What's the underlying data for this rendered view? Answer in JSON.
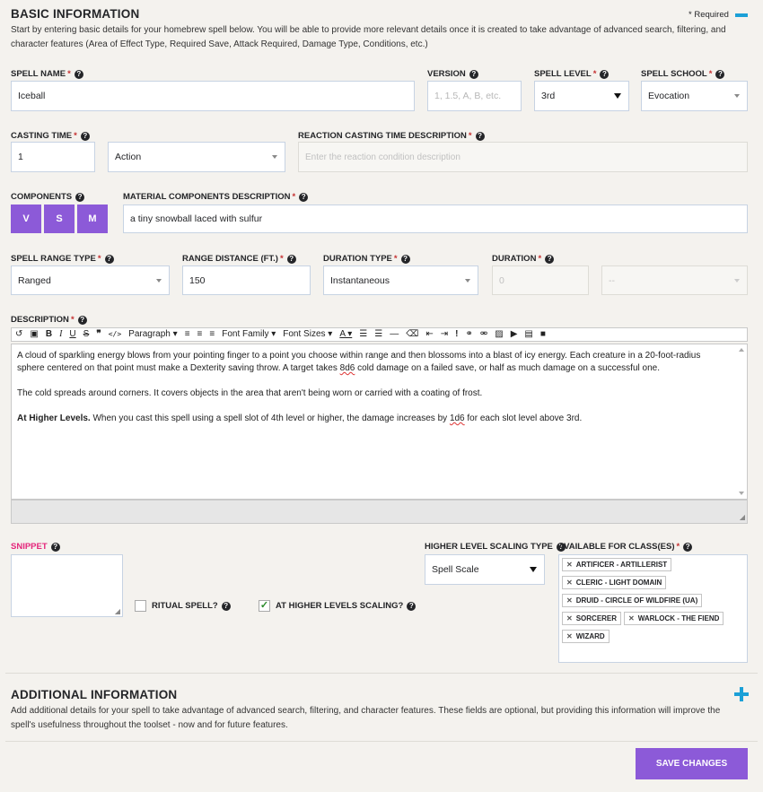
{
  "basic": {
    "title": "BASIC INFORMATION",
    "required_label": "* Required",
    "intro": "Start by entering basic details for your homebrew spell below. You will be able to provide more relevant details once it is created to take advantage of advanced search, filtering, and character features (Area of Effect Type, Required Save, Attack Required, Damage Type, Conditions, etc.)"
  },
  "fields": {
    "spell_name": {
      "label": "SPELL NAME",
      "value": "Iceball"
    },
    "version": {
      "label": "VERSION",
      "placeholder": "1, 1.5, A, B, etc."
    },
    "spell_level": {
      "label": "SPELL LEVEL",
      "value": "3rd"
    },
    "spell_school": {
      "label": "SPELL SCHOOL",
      "value": "Evocation"
    },
    "casting_time": {
      "label": "CASTING TIME",
      "value": "1",
      "unit": "Action"
    },
    "reaction_desc": {
      "label": "REACTION CASTING TIME DESCRIPTION",
      "placeholder": "Enter the reaction condition description"
    },
    "components": {
      "label": "COMPONENTS",
      "v": "V",
      "s": "S",
      "m": "M"
    },
    "material_desc": {
      "label": "MATERIAL COMPONENTS DESCRIPTION",
      "value": "a tiny snowball laced with sulfur"
    },
    "range_type": {
      "label": "SPELL RANGE TYPE",
      "value": "Ranged"
    },
    "range_distance": {
      "label": "RANGE DISTANCE (FT.)",
      "value": "150"
    },
    "duration_type": {
      "label": "DURATION TYPE",
      "value": "Instantaneous"
    },
    "duration": {
      "label": "DURATION",
      "value": "0",
      "unit": "--"
    }
  },
  "description": {
    "label": "DESCRIPTION",
    "toolbar": {
      "paragraph": "Paragraph",
      "font_family": "Font Family",
      "font_sizes": "Font Sizes"
    },
    "p1_a": "A cloud of sparkling energy blows from your pointing finger to a point you choose within range and then blossoms into a blast of icy energy. Each creature in a 20-foot-radius sphere centered on that point must make a Dexterity saving throw. A target takes ",
    "p1_dice": "8d6",
    "p1_b": " cold damage on a failed save, or half as much damage on a successful one.",
    "p2": "The cold spreads around corners. It covers objects in the area that aren't being worn or carried with a coating of frost.",
    "p3_bold": "At Higher Levels.",
    "p3_a": " When you cast this spell using a spell slot of 4th level or higher, the damage increases by ",
    "p3_dice": "1d6",
    "p3_b": " for each slot level above 3rd."
  },
  "snippet": {
    "label": "SNIPPET"
  },
  "ritual": {
    "label": "RITUAL SPELL?",
    "checked": false
  },
  "higher_scaling": {
    "label": "AT HIGHER LEVELS SCALING?",
    "checked": true
  },
  "scaling_type": {
    "label": "HIGHER LEVEL SCALING TYPE",
    "value": "Spell Scale"
  },
  "classes": {
    "label": "AVAILABLE FOR CLASS(ES)",
    "items": [
      "ARTIFICER - ARTILLERIST",
      "CLERIC - LIGHT DOMAIN",
      "DRUID - CIRCLE OF WILDFIRE (UA)",
      "SORCERER",
      "WARLOCK - THE FIEND",
      "WIZARD"
    ]
  },
  "additional": {
    "title": "ADDITIONAL INFORMATION",
    "intro": "Add additional details for your spell to take advantage of advanced search, filtering, and character features. These fields are optional, but providing this information will improve the spell's usefulness throughout the toolset - now and for future features."
  },
  "save_button": "SAVE CHANGES",
  "colors": {
    "accent": "#8c5ad8",
    "required": "#c53131",
    "snippet": "#e4267b",
    "info": "#1ba0d7"
  }
}
